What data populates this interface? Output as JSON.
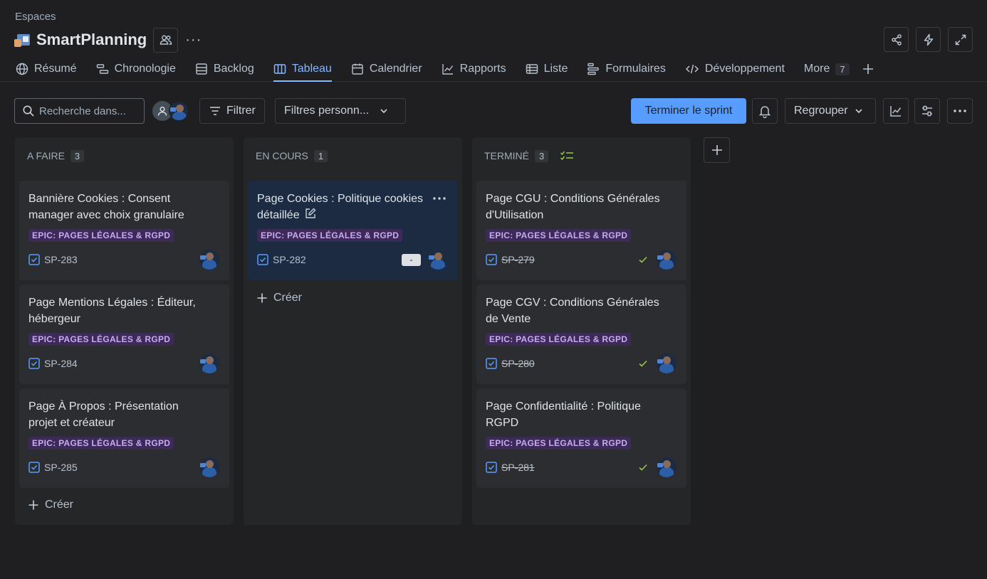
{
  "breadcrumb": "Espaces",
  "project": {
    "title": "SmartPlanning",
    "more_label": "···"
  },
  "tabs": [
    {
      "label": "Résumé"
    },
    {
      "label": "Chronologie"
    },
    {
      "label": "Backlog"
    },
    {
      "label": "Tableau"
    },
    {
      "label": "Calendrier"
    },
    {
      "label": "Rapports"
    },
    {
      "label": "Liste"
    },
    {
      "label": "Formulaires"
    },
    {
      "label": "Développement"
    }
  ],
  "more_tab": {
    "label": "More",
    "count": "7"
  },
  "toolbar": {
    "search_placeholder": "Recherche dans...",
    "filter_label": "Filtrer",
    "custom_filters_label": "Filtres personn...",
    "complete_sprint_label": "Terminer le sprint",
    "group_label": "Regrouper"
  },
  "columns": [
    {
      "title": "A FAIRE",
      "count": "3",
      "create_label": "Créer",
      "cards": [
        {
          "title": "Bannière Cookies : Consent manager avec choix granulaire",
          "epic": "EPIC: PAGES LÉGALES & RGPD",
          "key": "SP-283"
        },
        {
          "title": "Page Mentions Légales : Éditeur, hébergeur",
          "epic": "EPIC: PAGES LÉGALES & RGPD",
          "key": "SP-284"
        },
        {
          "title": "Page À Propos : Présentation projet et créateur",
          "epic": "EPIC: PAGES LÉGALES & RGPD",
          "key": "SP-285"
        }
      ]
    },
    {
      "title": "EN COURS",
      "count": "1",
      "create_label": "Créer",
      "cards": [
        {
          "title": "Page Cookies : Politique cookies détaillée",
          "epic": "EPIC: PAGES LÉGALES & RGPD",
          "key": "SP-282",
          "estimate": "-"
        }
      ]
    },
    {
      "title": "TERMINÉ",
      "count": "3",
      "cards": [
        {
          "title": "Page CGU : Conditions Générales d'Utilisation",
          "epic": "EPIC: PAGES LÉGALES & RGPD",
          "key": "SP-279"
        },
        {
          "title": "Page CGV : Conditions Générales de Vente",
          "epic": "EPIC: PAGES LÉGALES & RGPD",
          "key": "SP-280"
        },
        {
          "title": "Page Confidentialité : Politique RGPD",
          "epic": "EPIC: PAGES LÉGALES & RGPD",
          "key": "SP-281"
        }
      ]
    }
  ],
  "colors": {
    "accent": "#579dff",
    "epic_bg": "#3d2b57",
    "epic_text": "#c9a9f2",
    "done_check": "#94c748"
  }
}
